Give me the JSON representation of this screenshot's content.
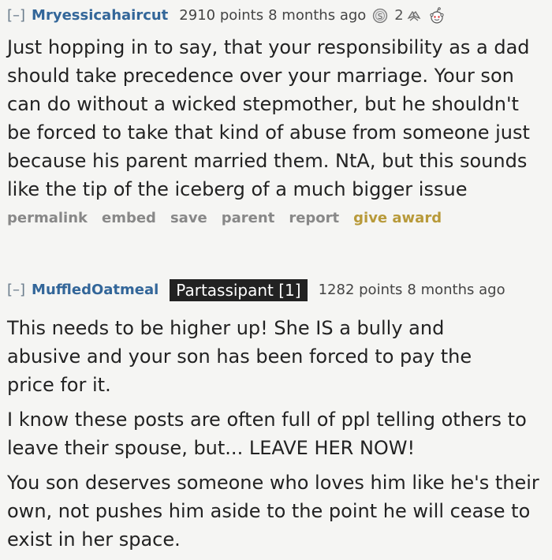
{
  "comments": [
    {
      "toggle": "[–]",
      "author": "Mryessicahaircut",
      "score": "2910 points",
      "time": "8 months ago",
      "award_count": "2",
      "paragraphs": [
        "Just hopping in to say, that your responsibility as a dad should take precedence over your marriage. Your son can do without a wicked stepmother, but he shouldn't be forced to take that kind of abuse from someone just because his parent married them. NtA, but this sounds like the tip of the iceberg of a much bigger issue"
      ],
      "buttons": {
        "permalink": "permalink",
        "embed": "embed",
        "save": "save",
        "parent": "parent",
        "report": "report",
        "give_award": "give award"
      },
      "icons": [
        "silver-award-icon",
        "helpful-hands-award-icon",
        "snoo-face-award-icon"
      ]
    },
    {
      "toggle": "[–]",
      "author": "MuffledOatmeal",
      "flair": "Partassipant [1]",
      "score": "1282 points",
      "time": "8 months ago",
      "paragraphs": [
        "This needs to be higher up! She IS a bully and abusive and your son has been forced to pay the price for it.",
        "I know these posts are often full of ppl telling others to leave their spouse, but... LEAVE HER NOW!",
        "You son deserves someone who loves him like he's their own, not pushes him aside to the point he will cease to exist in her space."
      ]
    }
  ],
  "colors": {
    "author": "#336699",
    "give_award": "#b89a3a",
    "flair_bg": "#222222",
    "background": "#f5f5f3"
  }
}
